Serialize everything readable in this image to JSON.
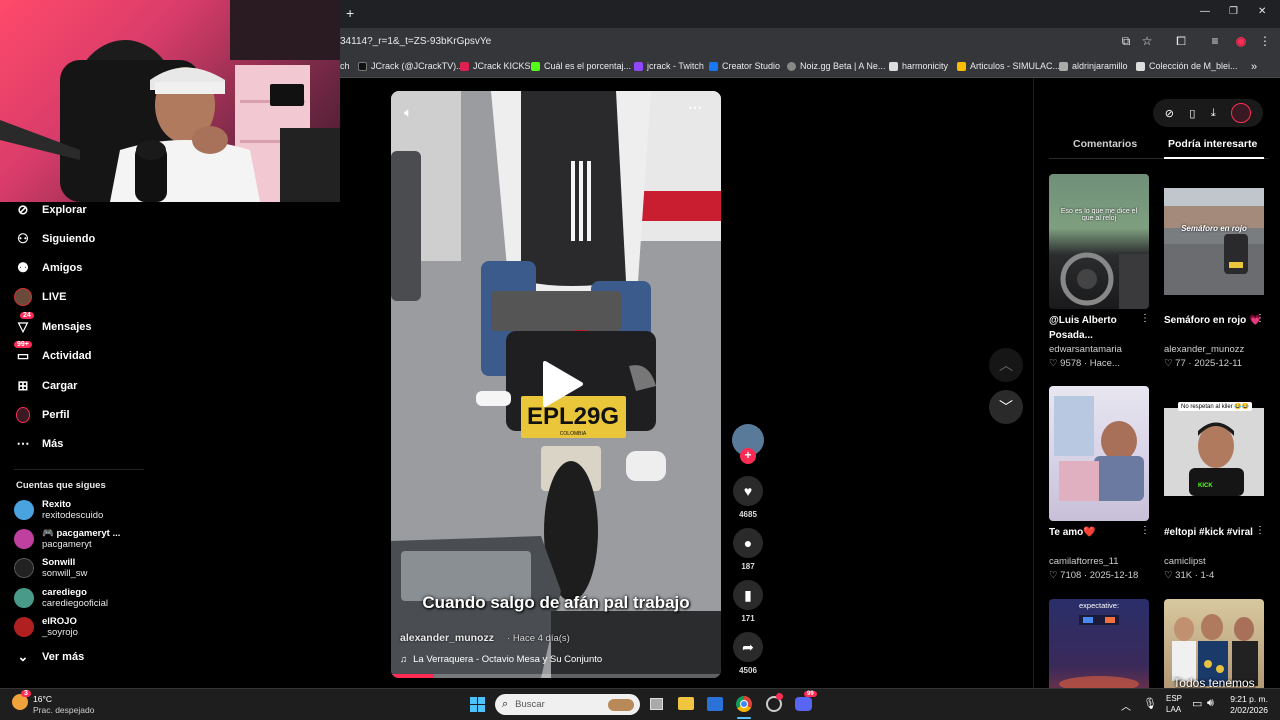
{
  "browser": {
    "new_tab": "+",
    "url": "34114?_r=1&_t=ZS-93bKrGpsvYe",
    "window_controls": [
      "—",
      "❐",
      "✕"
    ],
    "bookmarks": [
      {
        "label": "ch",
        "color": "#555"
      },
      {
        "label": "JCrack (@JCrackTV)...",
        "color": "#000"
      },
      {
        "label": "JCrack KICKS",
        "color": "#e02050"
      },
      {
        "label": "Cuál es el porcentaj...",
        "color": "#53fc18"
      },
      {
        "label": "jcrack - Twitch",
        "color": "#9146ff"
      },
      {
        "label": "Creator Studio",
        "color": "#1877f2"
      },
      {
        "label": "Noiz.gg Beta | A Ne...",
        "color": "#888"
      },
      {
        "label": "harmonicity",
        "color": "#ddd"
      },
      {
        "label": "Articulos - SIMULAC...",
        "color": "#fbbc04"
      },
      {
        "label": "aldrinjaramillo",
        "color": "#aaa"
      },
      {
        "label": "Colección de M_blei...",
        "color": "#ddd"
      }
    ],
    "more": "»"
  },
  "sidebar": {
    "nav": [
      {
        "label": "Explorar",
        "icon": "compass-icon"
      },
      {
        "label": "Siguiendo",
        "icon": "following-icon"
      },
      {
        "label": "Amigos",
        "icon": "friends-icon"
      },
      {
        "label": "LIVE",
        "icon": "live-icon"
      },
      {
        "label": "Mensajes",
        "icon": "messages-icon",
        "badge": "24"
      },
      {
        "label": "Actividad",
        "icon": "activity-icon",
        "badge": "99+"
      },
      {
        "label": "Cargar",
        "icon": "upload-icon"
      },
      {
        "label": "Perfil",
        "icon": "profile-icon"
      },
      {
        "label": "Más",
        "icon": "more-icon"
      }
    ],
    "following_title": "Cuentas que sigues",
    "following": [
      {
        "name": "Rexito",
        "handle": "rexitodescuido",
        "color": "#4aa3df"
      },
      {
        "name": "🎮 pacgameryt ...",
        "handle": "pacgameryt",
        "color": "#c040a0"
      },
      {
        "name": "Sonwill",
        "handle": "sonwill_sw",
        "color": "#222"
      },
      {
        "name": "carediego",
        "handle": "carediegooficial",
        "color": "#4a9a8a"
      },
      {
        "name": "elROJO",
        "handle": "_soyrojo",
        "color": "#b02020"
      }
    ],
    "see_more": "Ver más"
  },
  "video": {
    "caption": "Cuando salgo de afán pal trabajo",
    "author": "alexander_munozz",
    "posted": "Hace 4 día(s)",
    "music": "La Verraquera - Octavio Mesa y Su Conjunto",
    "plate": "EPL29G",
    "plate_country": "COLOMBIA",
    "progress": 0.13
  },
  "actions": {
    "likes": "4685",
    "comments": "187",
    "saves": "171",
    "shares": "4506"
  },
  "right_panel": {
    "tabs": [
      "Comentarios",
      "Podría interesarte"
    ],
    "active_tab": 1,
    "cards": [
      {
        "title": "@Luis Alberto Posada...",
        "user": "edwarsantamaria",
        "likes": "9578",
        "date": "Hace...",
        "overlay": "Eso es lo que me dice el que al reloj"
      },
      {
        "title": "Semáforo en rojo 💗",
        "user": "alexander_munozz",
        "likes": "77",
        "date": "2025-12-11",
        "overlay": "Semáforo en rojo"
      },
      {
        "title": "Te amo❤️",
        "user": "camilaftorres_11",
        "likes": "7108",
        "date": "2025-12-18",
        "overlay": ""
      },
      {
        "title": "#eltopi #kick #viral",
        "user": "camiclipst",
        "likes": "31K",
        "date": "1-4",
        "overlay": "No respetan al kiler 😂😂"
      },
      {
        "title": "",
        "user": "",
        "likes": "",
        "date": "",
        "overlay": "expectative:"
      },
      {
        "title": "",
        "user": "",
        "likes": "",
        "date": "",
        "overlay": "Todos tenemos"
      }
    ]
  },
  "taskbar": {
    "weather_temp": "16°C",
    "weather_desc": "Prac. despejado",
    "weather_badge": "3",
    "search_placeholder": "Buscar",
    "lang": "ESP",
    "lang2": "LAA",
    "time": "9:21 p. m.",
    "date": "2/02/2026",
    "discord_badge": "99"
  }
}
